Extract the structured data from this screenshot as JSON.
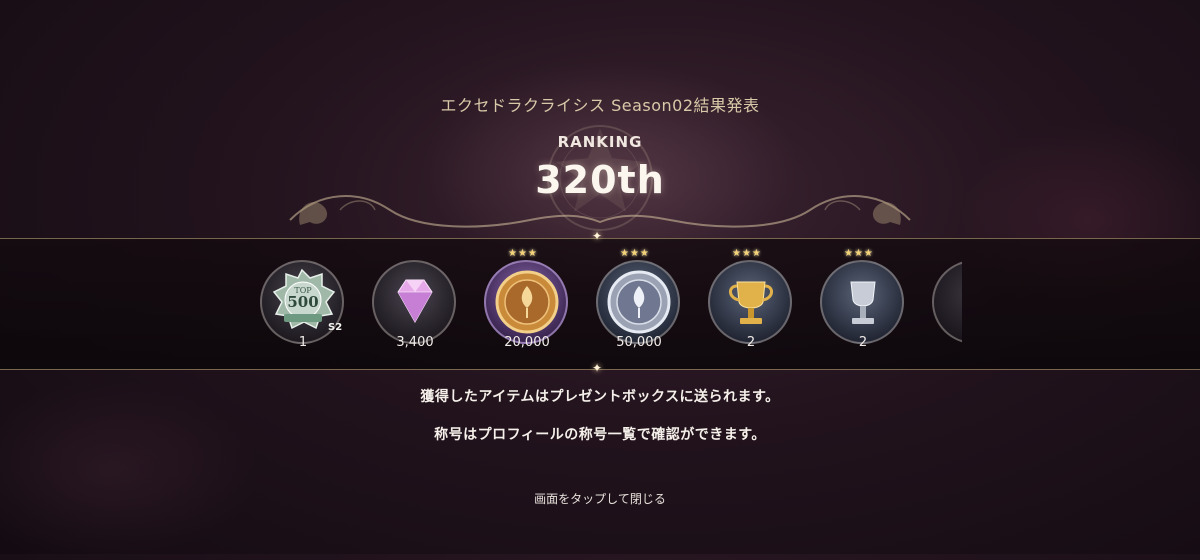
{
  "header": {
    "title": "エクセドラクライシス Season02結果発表",
    "ranking_label": "RANKING",
    "rank_value": "320th"
  },
  "rewards": [
    {
      "name": "top500-badge-icon",
      "quantity": "1",
      "stars": "",
      "badge_text": "TOP",
      "badge_number": "500",
      "badge_season": "S2"
    },
    {
      "name": "pink-gem-icon",
      "quantity": "3,400",
      "stars": ""
    },
    {
      "name": "gold-coin-icon",
      "quantity": "20,000",
      "stars": "★★★"
    },
    {
      "name": "silver-coin-icon",
      "quantity": "50,000",
      "stars": "★★★"
    },
    {
      "name": "gold-trophy-icon",
      "quantity": "2",
      "stars": "★★★"
    },
    {
      "name": "silver-trophy-icon",
      "quantity": "2",
      "stars": "★★★"
    }
  ],
  "messages": {
    "line1": "獲得したアイテムはプレゼントボックスに送られます。",
    "line2": "称号はプロフィールの称号一覧で確認ができます。",
    "tap_to_close": "画面をタップして閉じる"
  },
  "colors": {
    "accent_gold": "#d8c9a8",
    "background": "#22131d",
    "star": "#f3d27a"
  }
}
